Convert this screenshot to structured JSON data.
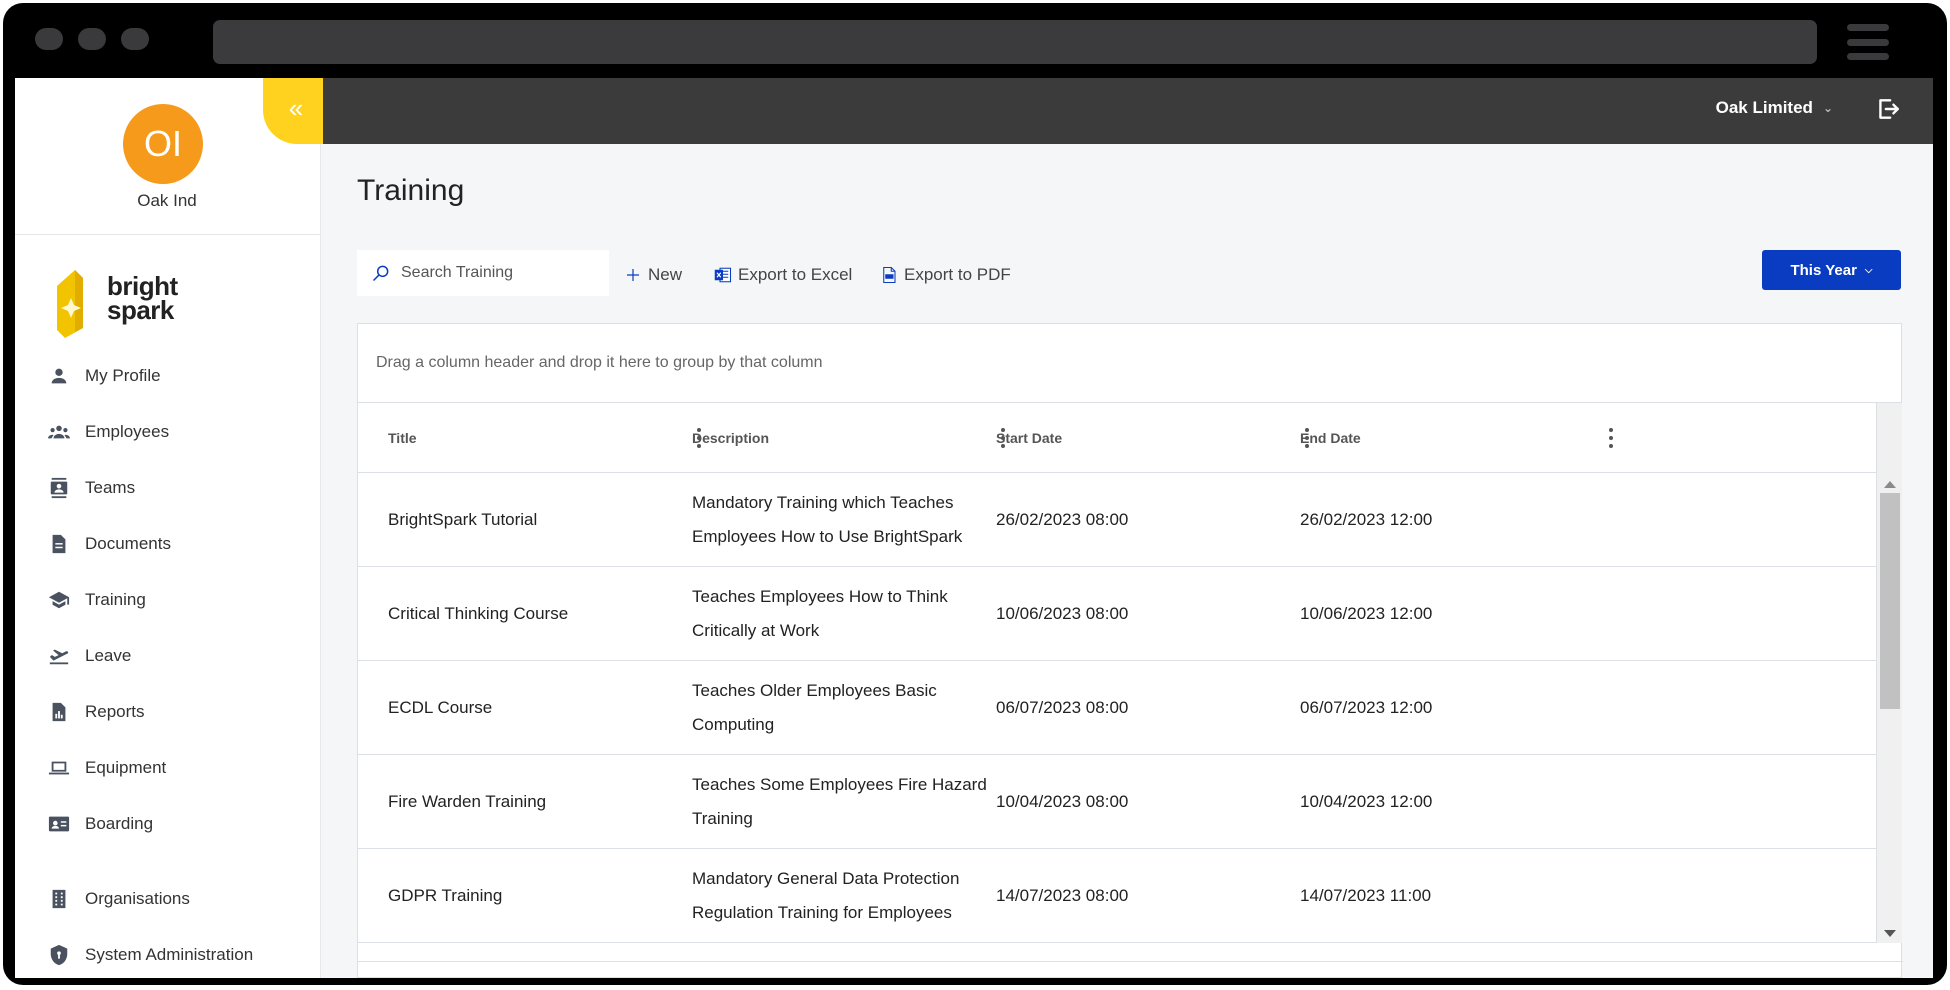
{
  "org": {
    "initials": "OI",
    "name": "Oak Ind"
  },
  "brand": {
    "line1": "bright",
    "line2": "spark",
    "color": "#ffd21f"
  },
  "collapse_icon": "«",
  "nav": [
    {
      "label": "My Profile",
      "icon": "person-icon"
    },
    {
      "label": "Employees",
      "icon": "people-icon"
    },
    {
      "label": "Teams",
      "icon": "contacts-icon"
    },
    {
      "label": "Documents",
      "icon": "document-icon"
    },
    {
      "label": "Training",
      "icon": "school-icon"
    },
    {
      "label": "Leave",
      "icon": "plane-icon"
    },
    {
      "label": "Reports",
      "icon": "report-icon"
    },
    {
      "label": "Equipment",
      "icon": "laptop-icon"
    },
    {
      "label": "Boarding",
      "icon": "id-card-icon"
    },
    {
      "label": "Organisations",
      "icon": "building-icon"
    },
    {
      "label": "System Administration",
      "icon": "shield-icon"
    }
  ],
  "topbar": {
    "company": "Oak Limited",
    "bg": "#3b3b3b"
  },
  "page": {
    "title": "Training"
  },
  "toolbar": {
    "search_placeholder": "Search Training",
    "new_label": "New",
    "excel_label": "Export to Excel",
    "pdf_label": "Export to PDF",
    "period_label": "This Year",
    "period_color": "#0a3cc2"
  },
  "grid": {
    "group_hint": "Drag a column header and drop it here to group by that column",
    "columns": [
      "Title",
      "Description",
      "Start Date",
      "End Date"
    ],
    "rows": [
      {
        "title": "BrightSpark Tutorial",
        "description": "Mandatory Training which Teaches Employees How to Use BrightSpark",
        "start": "26/02/2023 08:00",
        "end": "26/02/2023 12:00"
      },
      {
        "title": "Critical Thinking Course",
        "description": "Teaches Employees How to Think Critically at Work",
        "start": "10/06/2023 08:00",
        "end": "10/06/2023 12:00"
      },
      {
        "title": "ECDL Course",
        "description": "Teaches Older Employees Basic Computing",
        "start": "06/07/2023 08:00",
        "end": "06/07/2023 12:00"
      },
      {
        "title": "Fire Warden Training",
        "description": "Teaches Some Employees Fire Hazard Training",
        "start": "10/04/2023 08:00",
        "end": "10/04/2023 12:00"
      },
      {
        "title": "GDPR Training",
        "description": "Mandatory General Data Protection Regulation Training for Employees",
        "start": "14/07/2023 08:00",
        "end": "14/07/2023 11:00"
      }
    ]
  }
}
